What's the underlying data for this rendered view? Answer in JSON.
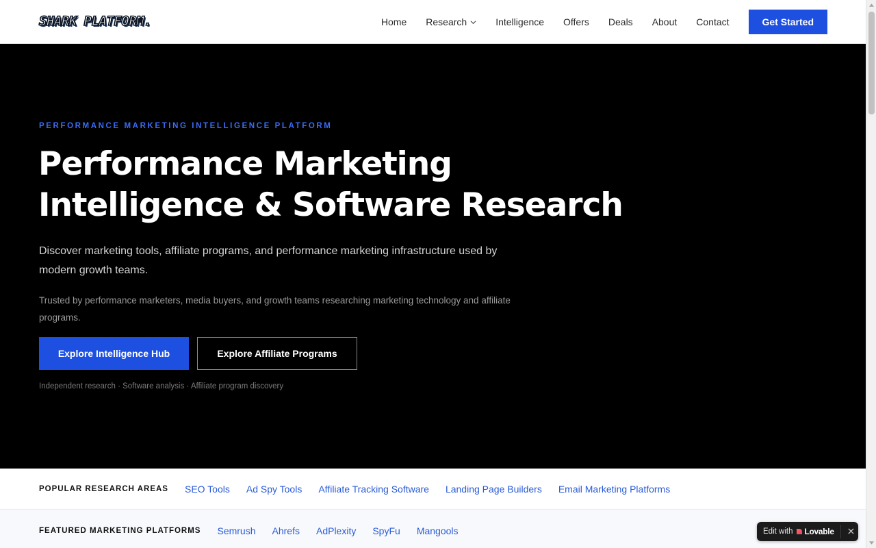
{
  "header": {
    "logo_text": "SHARK PLATFORM.",
    "nav": [
      {
        "label": "Home"
      },
      {
        "label": "Research",
        "has_dropdown": true
      },
      {
        "label": "Intelligence"
      },
      {
        "label": "Offers"
      },
      {
        "label": "Deals"
      },
      {
        "label": "About"
      },
      {
        "label": "Contact"
      }
    ],
    "cta_label": "Get Started"
  },
  "hero": {
    "eyebrow": "PERFORMANCE MARKETING INTELLIGENCE PLATFORM",
    "title_line1": "Performance Marketing",
    "title_line2": "Intelligence & Software Research",
    "lead": "Discover marketing tools, affiliate programs, and performance marketing infrastructure used by modern growth teams.",
    "trust": "Trusted by performance marketers, media buyers, and growth teams researching marketing technology and affiliate programs.",
    "primary_button": "Explore Intelligence Hub",
    "secondary_button": "Explore Affiliate Programs",
    "tagline": "Independent research · Software analysis · Affiliate program discovery"
  },
  "research_areas": {
    "label": "POPULAR RESEARCH AREAS",
    "links": [
      "SEO Tools",
      "Ad Spy Tools",
      "Affiliate Tracking Software",
      "Landing Page Builders",
      "Email Marketing Platforms"
    ]
  },
  "featured_platforms": {
    "label": "FEATURED MARKETING PLATFORMS",
    "links": [
      "Semrush",
      "Ahrefs",
      "AdPlexity",
      "SpyFu",
      "Mangools"
    ]
  },
  "badge": {
    "prefix": "Edit with",
    "brand": "Lovable",
    "close_icon": "close-icon"
  },
  "colors": {
    "accent": "#1d4fe0",
    "link": "#2a5bd7",
    "hero_bg": "#000000"
  }
}
